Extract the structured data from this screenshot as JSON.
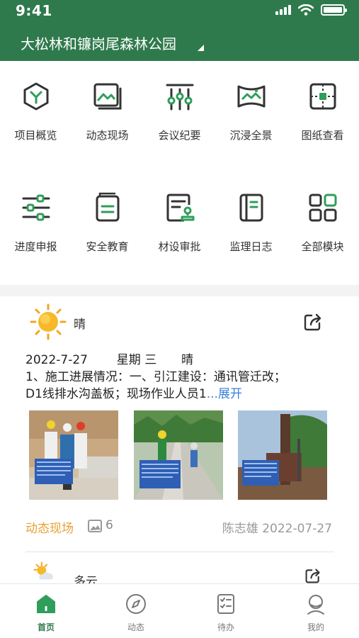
{
  "status_bar": {
    "time": "9:41"
  },
  "header": {
    "project_name": "大松林和镰岗尾森林公园"
  },
  "modules": [
    {
      "label": "项目概览",
      "icon": "cube-icon"
    },
    {
      "label": "动态现场",
      "icon": "gallery-icon"
    },
    {
      "label": "会议纪要",
      "icon": "meeting-icon"
    },
    {
      "label": "沉浸全景",
      "icon": "panorama-icon"
    },
    {
      "label": "图纸查看",
      "icon": "drawing-icon"
    },
    {
      "label": "进度申报",
      "icon": "sliders-icon"
    },
    {
      "label": "安全教育",
      "icon": "book-icon"
    },
    {
      "label": "材设审批",
      "icon": "approval-icon"
    },
    {
      "label": "监理日志",
      "icon": "log-icon"
    },
    {
      "label": "全部模块",
      "icon": "grid-icon"
    }
  ],
  "feed": {
    "weather": "晴",
    "date": "2022-7-27",
    "weekday": "星期 三",
    "weather_inline": "晴",
    "text_line1": "1、施工进展情况：一、引江建设：通讯管迁改；",
    "text_line2": "D1线排水沟盖板；现场作业人员1",
    "ellipsis": "...",
    "expand_label": "展开",
    "category": "动态现场",
    "photo_count": "6",
    "author": "陈志雄",
    "post_date": "2022-07-27",
    "next_weather": "多云"
  },
  "tabs": [
    {
      "label": "首页",
      "active": true
    },
    {
      "label": "动态",
      "active": false
    },
    {
      "label": "待办",
      "active": false
    },
    {
      "label": "我的",
      "active": false
    }
  ],
  "colors": {
    "brand_green": "#2f7a4c",
    "accent_orange": "#e7a232",
    "link_blue": "#3b7fd8"
  }
}
